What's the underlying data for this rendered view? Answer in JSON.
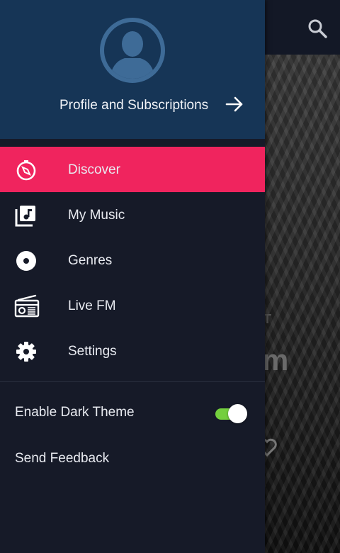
{
  "drawer": {
    "profile_label": "Profile and Subscriptions",
    "menu": [
      {
        "label": "Discover",
        "icon": "compass-icon",
        "active": true
      },
      {
        "label": "My Music",
        "icon": "music-library-icon",
        "active": false
      },
      {
        "label": "Genres",
        "icon": "disc-icon",
        "active": false
      },
      {
        "label": "Live FM",
        "icon": "radio-icon",
        "active": false
      },
      {
        "label": "Settings",
        "icon": "gear-icon",
        "active": false
      }
    ],
    "dark_theme_label": "Enable Dark Theme",
    "dark_theme_enabled": true,
    "feedback_label": "Send Feedback"
  },
  "background": {
    "partial_letter": "m",
    "partial_small": "T"
  },
  "colors": {
    "accent": "#f0245e",
    "header": "#163556",
    "drawer_bg": "#161a28",
    "toggle_on": "#74cf3e"
  }
}
